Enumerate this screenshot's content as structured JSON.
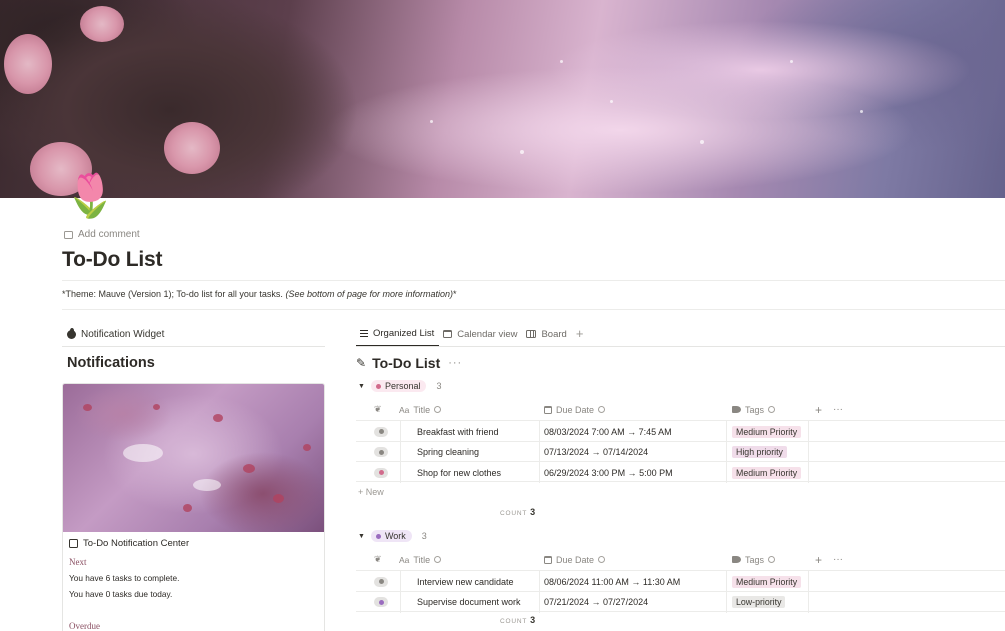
{
  "page": {
    "icon": "🌷",
    "add_comment": "Add comment",
    "title": "To-Do List",
    "theme_text": "*Theme: Mauve (Version 1); To-do list for all your tasks. ",
    "theme_italic": "(See bottom of page for more information)",
    "theme_tail": "*"
  },
  "left": {
    "widget_heading": "Notification Widget",
    "notifications_title": "Notifications",
    "widget": {
      "subtitle": "To-Do Notification Center",
      "next_label": "Next",
      "line1": "You have 6 tasks to complete.",
      "line2": "You have 0 tasks due today.",
      "overdue_label": "Overdue"
    }
  },
  "tabs": [
    {
      "label": "Organized List",
      "icon": "list-icon",
      "active": true
    },
    {
      "label": "Calendar view",
      "icon": "calendar-icon",
      "active": false
    },
    {
      "label": "Board",
      "icon": "board-icon",
      "active": false
    }
  ],
  "database": {
    "title": "To-Do List",
    "icon": "checklist-icon",
    "columns": {
      "status": "",
      "title_prefix": "Aa",
      "title": "Title",
      "due": "Due Date",
      "tags": "Tags"
    },
    "new_label": "+ New",
    "count_label": "COUNT",
    "groups": [
      {
        "name": "Personal",
        "count": "3",
        "pill_bg": "#fbe9f0",
        "dot": "#d16b8c",
        "rows": [
          {
            "title": "Breakfast with friend",
            "due": "08/03/2024 7:00 AM → 7:45 AM",
            "tag": "Medium Priority",
            "tag_bg": "#f6e1ea",
            "status_color": "#8a8782"
          },
          {
            "title": "Spring cleaning",
            "due": "07/13/2024 → 07/14/2024",
            "tag": "High priority",
            "tag_bg": "#f0dcea",
            "status_color": "#8a8782"
          },
          {
            "title": "Shop for new clothes",
            "due": "06/29/2024 3:00 PM → 5:00 PM",
            "tag": "Medium Priority",
            "tag_bg": "#f6e1ea",
            "status_color": "#d16b8c"
          }
        ],
        "footer_count": "3"
      },
      {
        "name": "Work",
        "count": "3",
        "pill_bg": "#efe5f6",
        "dot": "#9a6cbf",
        "rows": [
          {
            "title": "Interview new candidate",
            "due": "08/06/2024 11:00 AM → 11:30 AM",
            "tag": "Medium Priority",
            "tag_bg": "#f6e1ea",
            "status_color": "#8a8782"
          },
          {
            "title": "Supervise document work",
            "due": "07/21/2024 → 07/27/2024",
            "tag": "Low-priority",
            "tag_bg": "#e9e8e6",
            "status_color": "#9a6cbf"
          }
        ],
        "footer_count": "3"
      }
    ]
  }
}
